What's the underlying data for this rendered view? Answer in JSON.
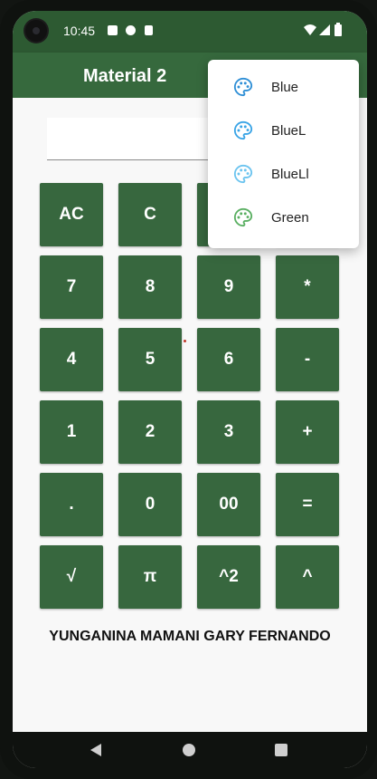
{
  "status_bar": {
    "time": "10:45",
    "icons": [
      "camera-icon",
      "notification-a-icon",
      "notification-f-icon",
      "sd-card-icon",
      "wifi-icon",
      "signal-icon",
      "battery-icon"
    ]
  },
  "app_bar": {
    "title": "Material 2"
  },
  "display": {
    "value": ""
  },
  "keypad": {
    "keys": [
      {
        "name": "key-ac",
        "label": "AC"
      },
      {
        "name": "key-c",
        "label": "C"
      },
      {
        "name": "key-hidden-1",
        "label": ""
      },
      {
        "name": "key-hidden-2",
        "label": ""
      },
      {
        "name": "key-7",
        "label": "7"
      },
      {
        "name": "key-8",
        "label": "8"
      },
      {
        "name": "key-9",
        "label": "9"
      },
      {
        "name": "key-multiply",
        "label": "*"
      },
      {
        "name": "key-4",
        "label": "4"
      },
      {
        "name": "key-5",
        "label": "5"
      },
      {
        "name": "key-6",
        "label": "6"
      },
      {
        "name": "key-minus",
        "label": "-"
      },
      {
        "name": "key-1",
        "label": "1"
      },
      {
        "name": "key-2",
        "label": "2"
      },
      {
        "name": "key-3",
        "label": "3"
      },
      {
        "name": "key-plus",
        "label": "+"
      },
      {
        "name": "key-decimal",
        "label": "."
      },
      {
        "name": "key-0",
        "label": "0"
      },
      {
        "name": "key-00",
        "label": "00"
      },
      {
        "name": "key-equals",
        "label": "="
      },
      {
        "name": "key-sqrt",
        "label": "√"
      },
      {
        "name": "key-pi",
        "label": "π"
      },
      {
        "name": "key-square",
        "label": "^2"
      },
      {
        "name": "key-power",
        "label": "^"
      }
    ]
  },
  "author": "YUNGANINA MAMANI GARY FERNANDO",
  "theme_menu": {
    "items": [
      {
        "name": "menu-item-blue",
        "label": "Blue",
        "icon": "palette-icon",
        "color": "#2f8fd6"
      },
      {
        "name": "menu-item-bluel",
        "label": "BlueL",
        "icon": "palette-icon",
        "color": "#3aa4e6"
      },
      {
        "name": "menu-item-bluell",
        "label": "BlueLl",
        "icon": "palette-icon",
        "color": "#6cc4ef"
      },
      {
        "name": "menu-item-green",
        "label": "Green",
        "icon": "palette-icon",
        "color": "#5aaf62"
      }
    ]
  },
  "nav_bar": {
    "buttons": [
      "back-icon",
      "home-icon",
      "recents-icon"
    ]
  },
  "colors": {
    "primary": "#36693d",
    "primary_dark": "#2d5a32",
    "key": "#37673e",
    "background": "#f8f8f8"
  }
}
